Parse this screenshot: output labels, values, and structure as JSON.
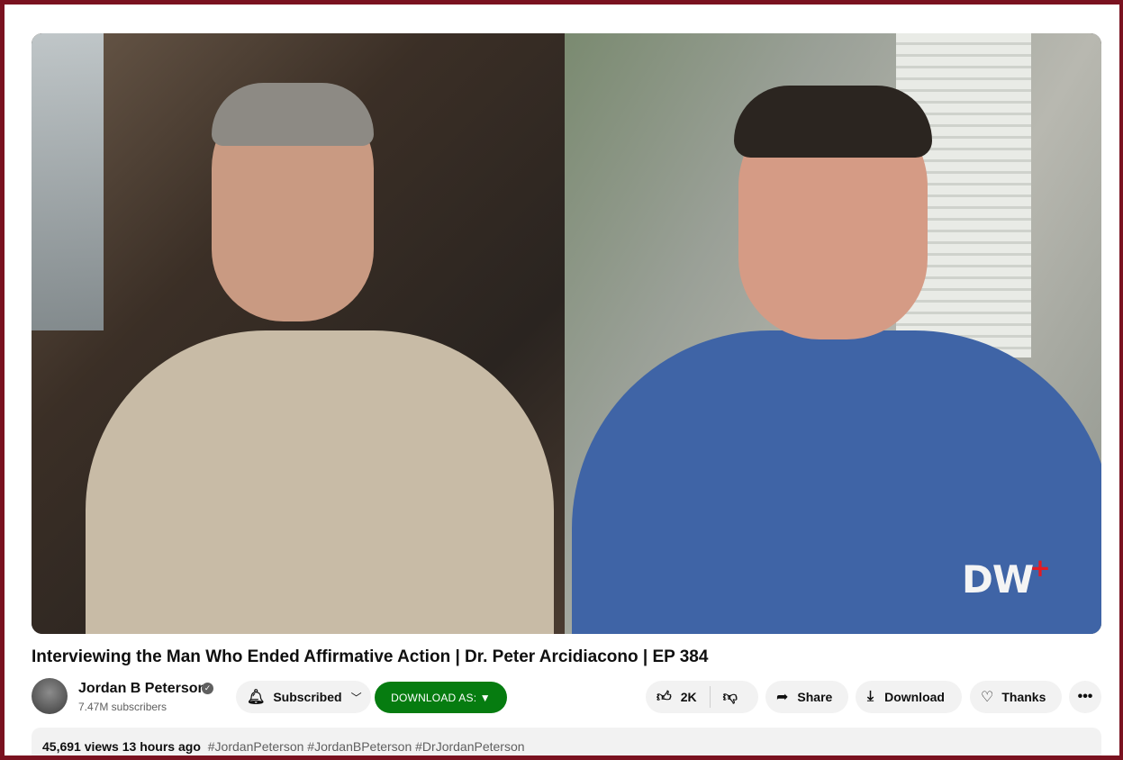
{
  "video": {
    "overlay_logo": "DW",
    "overlay_logo_plus": "+"
  },
  "title": "Interviewing the Man Who Ended Affirmative Action | Dr. Peter Arcidiacono | EP 384",
  "channel": {
    "name": "Jordan B Peterson",
    "verified_icon": "✓",
    "subscribers": "7.47M subscribers"
  },
  "actions": {
    "subscribed_label": "Subscribed",
    "download_as_label": "DOWNLOAD AS: ▼",
    "like_count": "2K",
    "share_label": "Share",
    "download_label": "Download",
    "thanks_label": "Thanks",
    "more_label": "•••"
  },
  "description": {
    "stats": "45,691 views  13 hours ago",
    "tags": "#JordanPeterson #JordanBPeterson #DrJordanPeterson"
  },
  "colors": {
    "frame": "#7a1220",
    "download_as_bg": "#067c10",
    "pill_bg": "#f2f2f2"
  }
}
